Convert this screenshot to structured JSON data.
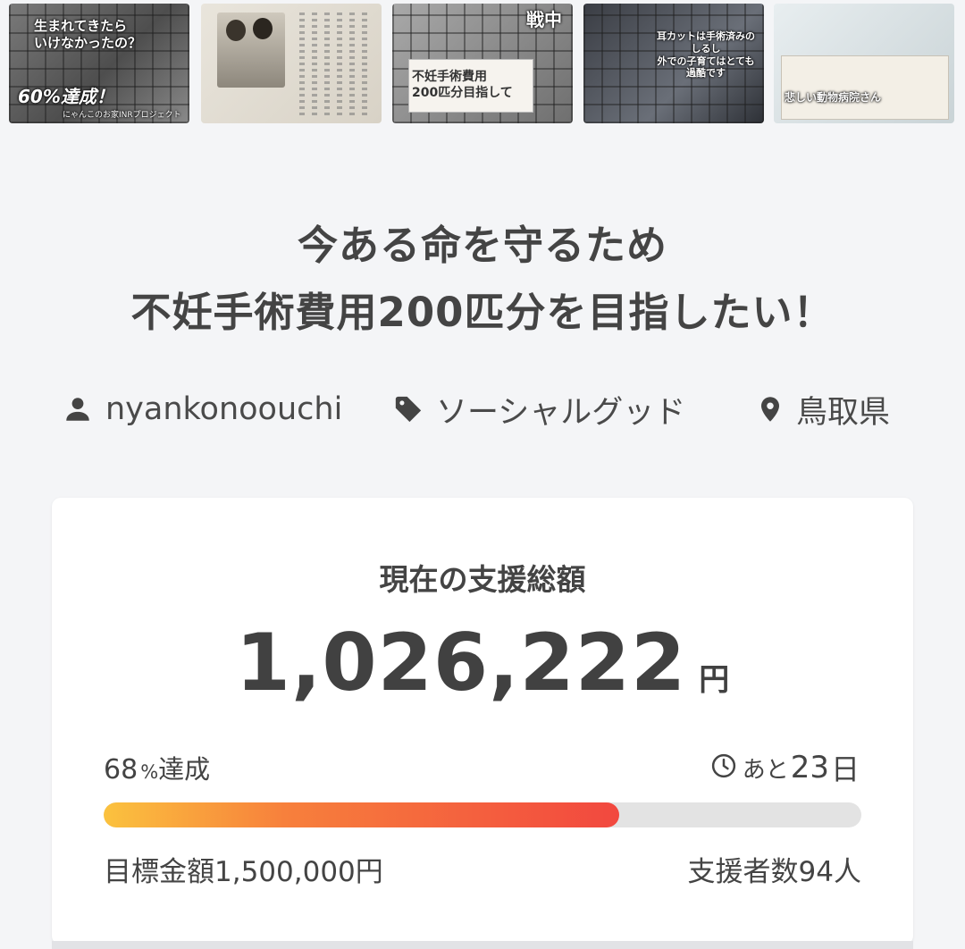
{
  "gallery": {
    "thumbnails": [
      {
        "caption_top": "生まれてきたら\nいけなかったの？",
        "caption_mid": "60%達成！",
        "caption_bottom": "にゃんこのお家INRプロジェクト"
      },
      {
        "caption_top": ""
      },
      {
        "caption_top": "不妊手術費用\n200匹分目指して",
        "caption_side": "戦中"
      },
      {
        "caption_top": "耳カットは手術済みの\nしるし\n外での子育てはとても\n過酷です"
      },
      {
        "caption_top": "悲しい動物病院さん"
      }
    ]
  },
  "project": {
    "title_line1": "今ある命を守るため",
    "title_line2": "不妊手術費用200匹分を目指したい！",
    "owner": "nyankonoouchi",
    "category": "ソーシャルグッド",
    "location": "鳥取県"
  },
  "funding": {
    "label": "現在の支援総額",
    "amount": "1,026,222",
    "currency": "円",
    "percent": "68",
    "percent_unit": "%",
    "percent_suffix": "達成",
    "progress": 0.68,
    "days_prefix": "あと",
    "days_left": "23",
    "days_suffix": "日",
    "goal_text": "目標金額1,500,000円",
    "backers_text": "支援者数94人"
  },
  "colors": {
    "progress_start": "#fbc23e",
    "progress_end": "#f2483f",
    "background": "#f4f5f7"
  }
}
